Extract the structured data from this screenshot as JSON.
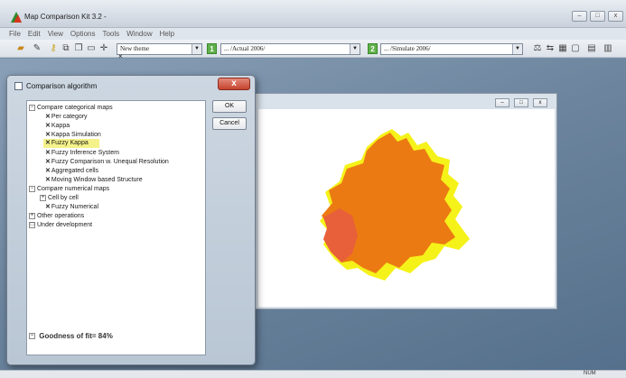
{
  "app": {
    "title": "Map Comparison Kit 3.2 -"
  },
  "window_controls": {
    "minimize": "–",
    "maximize": "□",
    "close": "x"
  },
  "menu": [
    "File",
    "Edit",
    "View",
    "Options",
    "Tools",
    "Window",
    "Help"
  ],
  "toolbar": {
    "theme_value": "New theme",
    "map1_number": "1",
    "map1_value": "... /Actual 2006/",
    "map2_number": "2",
    "map2_value": "... /Simulate 2006/"
  },
  "panel": {
    "close_label": "×"
  },
  "dialog": {
    "title": "Comparison algorithm",
    "close_label": "x",
    "ok_label": "OK",
    "cancel_label": "Cancel",
    "tree": [
      {
        "label": "Compare categorical maps",
        "expander": "−"
      },
      {
        "label": "Per category"
      },
      {
        "label": "Kappa"
      },
      {
        "label": "Kappa Simulation"
      },
      {
        "label": "Fuzzy Kappa"
      },
      {
        "label": "Fuzzy Inference System"
      },
      {
        "label": "Fuzzy Comparison w. Unequal Resolution"
      },
      {
        "label": "Aggregated cells"
      },
      {
        "label": "Moving Window based Structure"
      },
      {
        "label": "Compare numerical maps",
        "expander": "−"
      },
      {
        "label": "Cell by cell",
        "expander": "+"
      },
      {
        "label": "Fuzzy Numerical"
      },
      {
        "label": "Other operations",
        "expander": "+"
      },
      {
        "label": "Under development",
        "expander": "□"
      }
    ],
    "goodness_label": "Goodness of fit= 84%",
    "goodness_expander": "−"
  },
  "map_window_controls": {
    "minimize": "–",
    "maximize": "□",
    "close": "x"
  },
  "status": {
    "num": "NUM"
  },
  "colors": {
    "map_orange": "#ec7a12",
    "map_yellow": "#f5f219",
    "highlight": "#f5f28a"
  }
}
